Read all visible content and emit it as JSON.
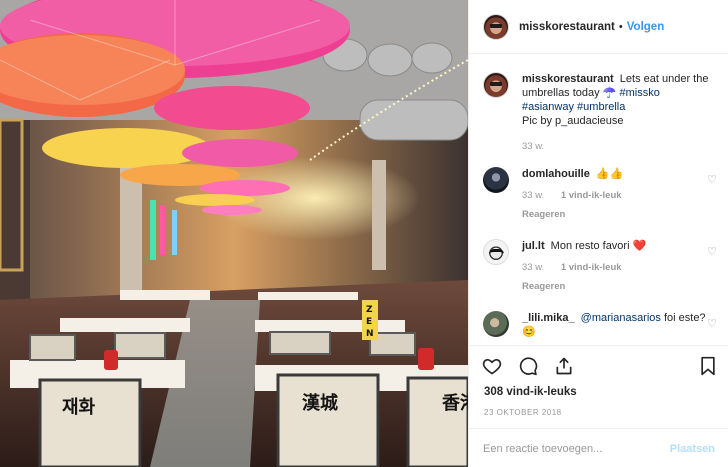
{
  "photo": {
    "sign_texts": [
      "재화",
      "漢城",
      "香港"
    ],
    "zen_letters": [
      "Z",
      "E",
      "N"
    ]
  },
  "header": {
    "username": "misskorestaurant",
    "separator": "•",
    "follow_label": "Volgen"
  },
  "caption": {
    "username": "misskorestaurant",
    "text": "Lets eat under the umbrellas today ☂️",
    "hashtags": [
      "#missko",
      "#asianway",
      "#umbrella"
    ],
    "credit": "Pic by p_audacieuse",
    "time": "33 w."
  },
  "comments": [
    {
      "username": "domlahouille",
      "text": "👍👍",
      "time": "33 w.",
      "likes": "1 vind-ik-leuk",
      "reply": "Reageren"
    },
    {
      "username": "jul.lt",
      "text": "Mon resto favori ❤️",
      "time": "33 w.",
      "likes": "1 vind-ik-leuk",
      "reply": "Reageren"
    },
    {
      "username": "_lili.mika_",
      "mention": "@marianasarios",
      "text": "foi este? 😊",
      "time": "",
      "likes": "",
      "reply": ""
    }
  ],
  "post": {
    "likes": "308 vind-ik-leuks",
    "date": "23 OKTOBER 2018"
  },
  "add_comment": {
    "placeholder": "Een reactie toevoegen...",
    "post_label": "Plaatsen"
  },
  "colors": {
    "link": "#3897f0",
    "hashtag": "#003569",
    "muted": "#999999",
    "post_disabled": "#b2dffc"
  },
  "icons": [
    "heart-icon",
    "comment-icon",
    "share-icon",
    "bookmark-icon"
  ]
}
